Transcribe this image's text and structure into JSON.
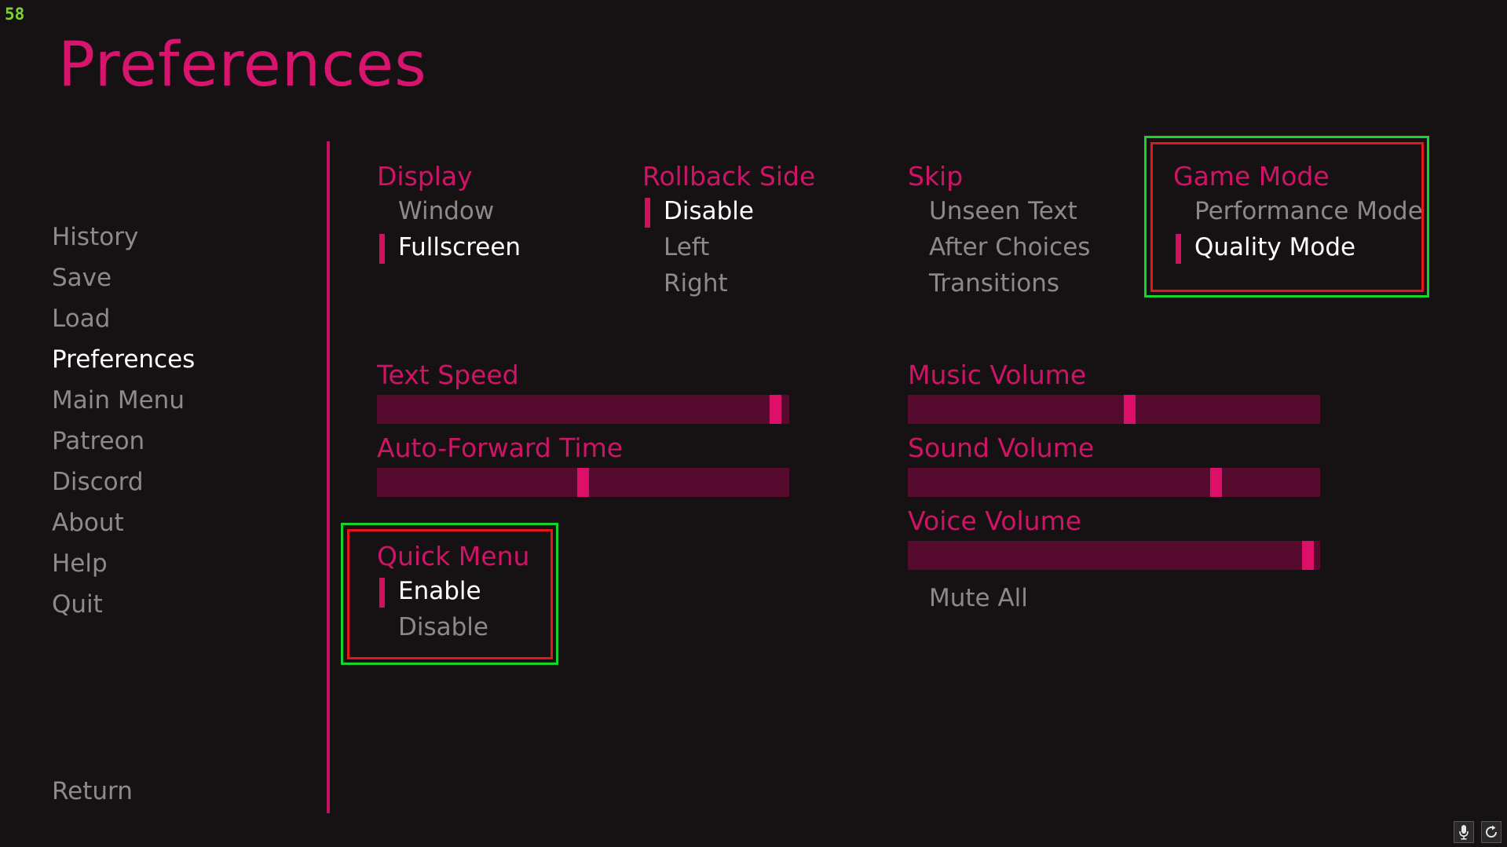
{
  "fps": "58",
  "title": "Preferences",
  "nav": {
    "items": [
      {
        "label": "History",
        "active": false
      },
      {
        "label": "Save",
        "active": false
      },
      {
        "label": "Load",
        "active": false
      },
      {
        "label": "Preferences",
        "active": true
      },
      {
        "label": "Main Menu",
        "active": false
      },
      {
        "label": "Patreon",
        "active": false
      },
      {
        "label": "Discord",
        "active": false
      },
      {
        "label": "About",
        "active": false
      },
      {
        "label": "Help",
        "active": false
      },
      {
        "label": "Quit",
        "active": false
      }
    ],
    "return_label": "Return"
  },
  "groups": {
    "display": {
      "label": "Display",
      "options": [
        "Window",
        "Fullscreen"
      ],
      "selected": 1
    },
    "rollback": {
      "label": "Rollback Side",
      "options": [
        "Disable",
        "Left",
        "Right"
      ],
      "selected": 0
    },
    "skip": {
      "label": "Skip",
      "options": [
        "Unseen Text",
        "After Choices",
        "Transitions"
      ],
      "selected": -1
    },
    "game_mode": {
      "label": "Game Mode",
      "options": [
        "Performance Mode",
        "Quality Mode"
      ],
      "selected": 1
    },
    "quick_menu": {
      "label": "Quick Menu",
      "options": [
        "Enable",
        "Disable"
      ],
      "selected": 0
    }
  },
  "sliders": {
    "text_speed": {
      "label": "Text Speed",
      "value": 0.98
    },
    "auto_forward": {
      "label": "Auto-Forward Time",
      "value": 0.5
    },
    "music_volume": {
      "label": "Music Volume",
      "value": 0.54
    },
    "sound_volume": {
      "label": "Sound Volume",
      "value": 0.755
    },
    "voice_volume": {
      "label": "Voice Volume",
      "value": 0.985
    }
  },
  "mute_all_label": "Mute All",
  "colors": {
    "accent": "#d7146e",
    "track": "#560a2e",
    "background": "#161214",
    "highlight_outer": "#17d42a",
    "highlight_inner": "#e8141c"
  },
  "icons": {
    "corner_left": "microphone-icon",
    "corner_right": "refresh-icon"
  }
}
